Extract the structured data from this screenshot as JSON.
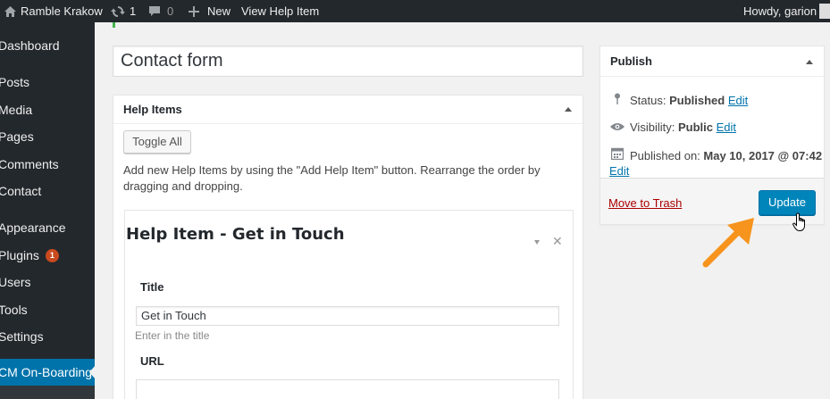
{
  "adminbar": {
    "site_name": "Ramble Krakow",
    "updates_count": "1",
    "comments_count": "0",
    "new_label": "New",
    "view_label": "View Help Item",
    "howdy": "Howdy, garion",
    "icons": [
      "home-icon",
      "updates-icon",
      "comments-icon",
      "plus-icon"
    ]
  },
  "sidebar": {
    "items": [
      {
        "label": "Dashboard"
      },
      {
        "label": "Posts"
      },
      {
        "label": "Media"
      },
      {
        "label": "Pages"
      },
      {
        "label": "Comments"
      },
      {
        "label": "Contact"
      },
      {
        "label": "Appearance"
      },
      {
        "label": "Plugins",
        "badge": "1"
      },
      {
        "label": "Users"
      },
      {
        "label": "Tools"
      },
      {
        "label": "Settings"
      },
      {
        "label": "CM On-Boarding",
        "current": true
      }
    ]
  },
  "post": {
    "title_value": "Contact form"
  },
  "help_items_box": {
    "heading": "Help Items",
    "toggle_all": "Toggle All",
    "description": "Add new Help Items by using the \"Add Help Item\" button. Rearrange the order by dragging and dropping.",
    "item": {
      "heading": "Help Item - Get in Touch",
      "remove_glyph": "✕",
      "title_label": "Title",
      "title_value": "Get in Touch",
      "title_hint": "Enter in the title",
      "url_label": "URL",
      "url_value": ""
    }
  },
  "publish_box": {
    "heading": "Publish",
    "status_label": "Status:",
    "status_value": "Published",
    "visibility_label": "Visibility:",
    "visibility_value": "Public",
    "published_label": "Published on:",
    "published_value": "May 10, 2017 @ 07:42",
    "edit_label": "Edit",
    "trash_label": "Move to Trash",
    "update_label": "Update"
  },
  "colors": {
    "adminbar": "#23282d",
    "accent": "#0073aa",
    "button_primary": "#0085ba",
    "badge": "#ca4a1f",
    "trash": "#a00",
    "annotation_arrow": "#f7941d"
  }
}
